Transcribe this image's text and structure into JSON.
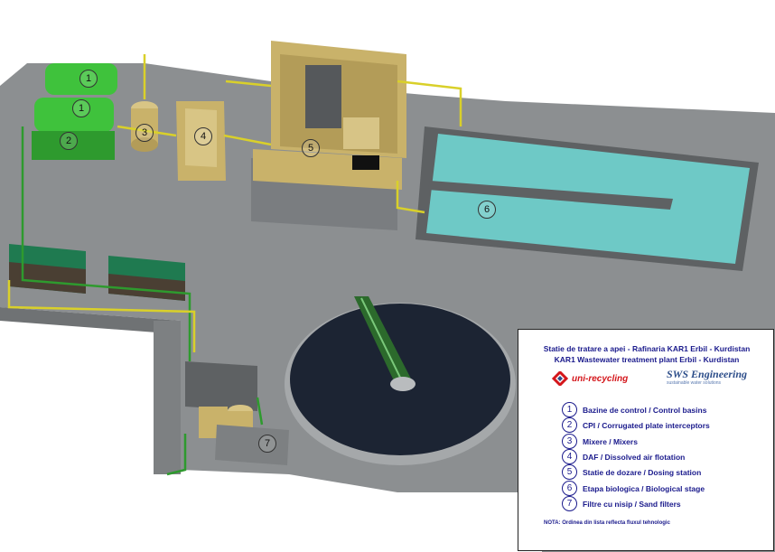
{
  "markers": [
    "1",
    "1",
    "2",
    "3",
    "4",
    "5",
    "6",
    "7"
  ],
  "legend": {
    "title_ro": "Statie de tratare a apei - Rafinaria KAR1  Erbil - Kurdistan",
    "title_en": "KAR1 Wastewater treatment plant Erbil - Kurdistan",
    "logo_left": "uni-recycling",
    "logo_right": "SWS Engineering",
    "logo_right_sub": "sustainable water solutions",
    "items": [
      {
        "num": "1",
        "text": "Bazine de control / Control basins"
      },
      {
        "num": "2",
        "text": "CPI / Corrugated plate interceptors"
      },
      {
        "num": "3",
        "text": "Mixere / Mixers"
      },
      {
        "num": "4",
        "text": "DAF / Dissolved air flotation"
      },
      {
        "num": "5",
        "text": "Statie de dozare / Dosing station"
      },
      {
        "num": "6",
        "text": "Etapa biologica / Biological stage"
      },
      {
        "num": "7",
        "text": "Filtre cu nisip / Sand filters"
      }
    ],
    "note": "NOTA: Ordinea din lista reflecta fluxul tehnologic"
  },
  "colors": {
    "ground": "#8c8f91",
    "building": "#c9b26a",
    "tank_green": "#3fc23c",
    "basin_water": "#6ec9c6",
    "clarifier": "#1c2433",
    "pipe_yellow": "#d9d02a",
    "pipe_green": "#2e9a2e",
    "legend_text": "#1a1a8c",
    "logo_red": "#d4161b"
  }
}
